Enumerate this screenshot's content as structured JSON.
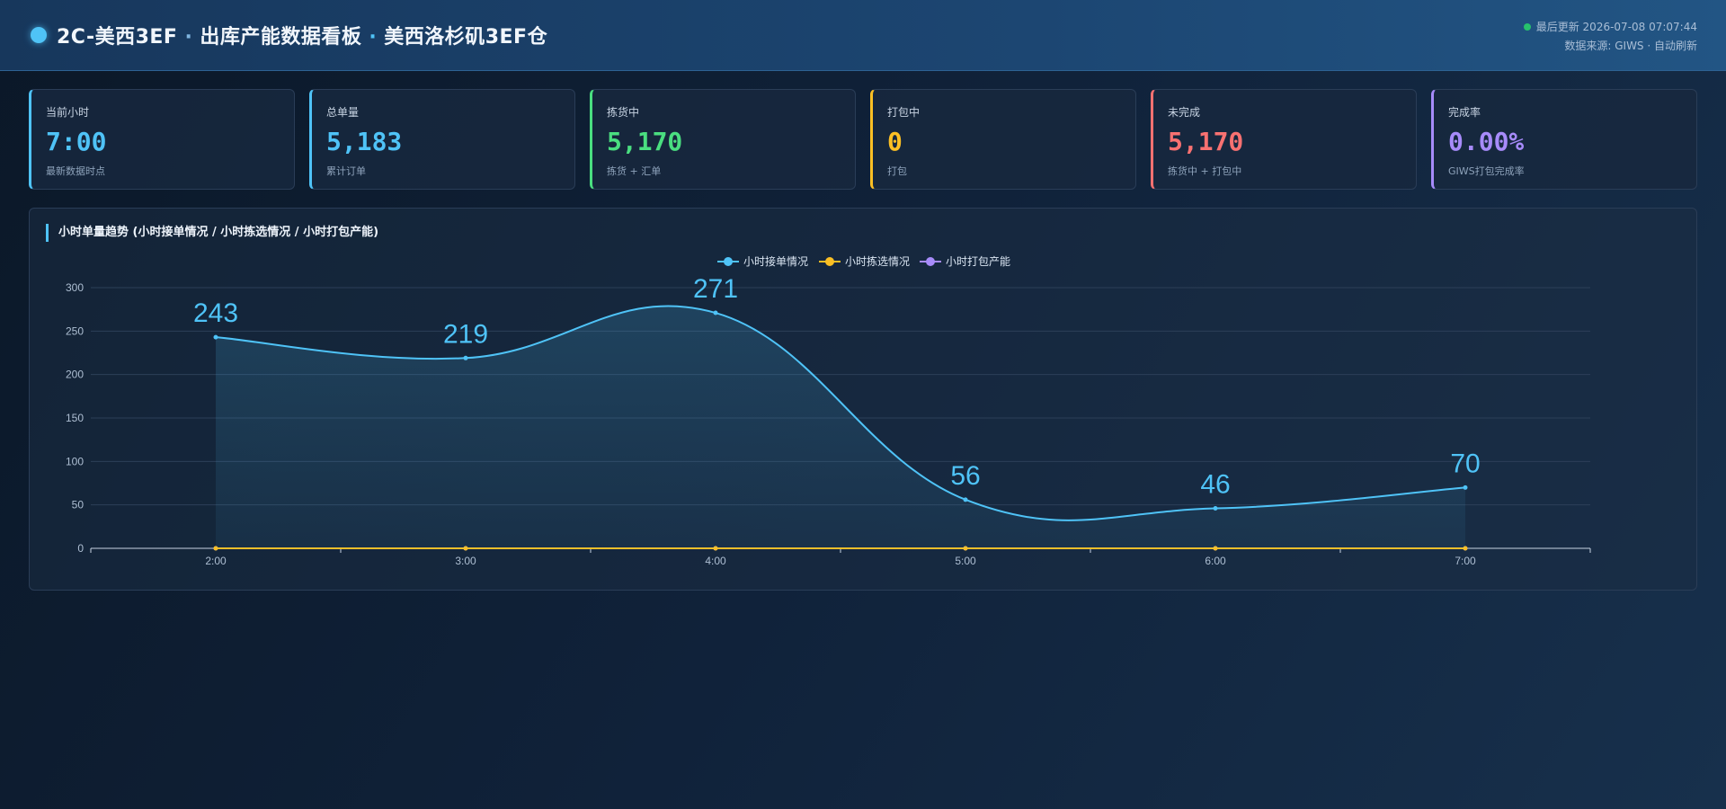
{
  "header": {
    "title_part1": "2C-美西3EF",
    "title_sep": "·",
    "title_part2": "出库产能数据看板",
    "title_part3": "美西洛杉矶3EF仓",
    "last_update": "最后更新 2026-07-08 07:07:44",
    "source": "数据来源: GIWS · 自动刷新"
  },
  "colors": {
    "accent": "#4fc3f7",
    "green": "#4ade80",
    "yellow": "#fbbf24",
    "red": "#f87171",
    "purple": "#a78bfa"
  },
  "cards": [
    {
      "label": "当前小时",
      "value": "7:00",
      "sub": "最新数据时点",
      "color": "#4fc3f7"
    },
    {
      "label": "总单量",
      "value": "5,183",
      "sub": "累计订单",
      "color": "#4fc3f7"
    },
    {
      "label": "拣货中",
      "value": "5,170",
      "sub": "拣货 + 汇单",
      "color": "#4ade80"
    },
    {
      "label": "打包中",
      "value": "0",
      "sub": "打包",
      "color": "#fbbf24"
    },
    {
      "label": "未完成",
      "value": "5,170",
      "sub": "拣货中 + 打包中",
      "color": "#f87171"
    },
    {
      "label": "完成率",
      "value": "0.00%",
      "sub": "GIWS打包完成率",
      "color": "#a78bfa"
    }
  ],
  "panel": {
    "title": "小时单量趋势 (小时接单情况 / 小时拣选情况 / 小时打包产能)"
  },
  "chart_data": {
    "type": "line",
    "smooth": true,
    "categories": [
      "2:00",
      "3:00",
      "4:00",
      "5:00",
      "6:00",
      "7:00"
    ],
    "ylim": [
      0,
      300
    ],
    "yticks": [
      0,
      50,
      100,
      150,
      200,
      250,
      300
    ],
    "grid": true,
    "legend_position": "top-center",
    "series": [
      {
        "name": "小时接单情况",
        "values": [
          243,
          219,
          271,
          56,
          46,
          70
        ],
        "color": "#4fc3f7",
        "area": true,
        "show_labels": true
      },
      {
        "name": "小时拣选情况",
        "values": [
          0,
          0,
          0,
          0,
          0,
          0
        ],
        "color": "#fbbf24",
        "area": false,
        "show_labels": false
      },
      {
        "name": "小时打包产能",
        "values": [
          0,
          0,
          0,
          0,
          0,
          0
        ],
        "color": "#a78bfa",
        "area": false,
        "show_labels": false
      }
    ]
  }
}
